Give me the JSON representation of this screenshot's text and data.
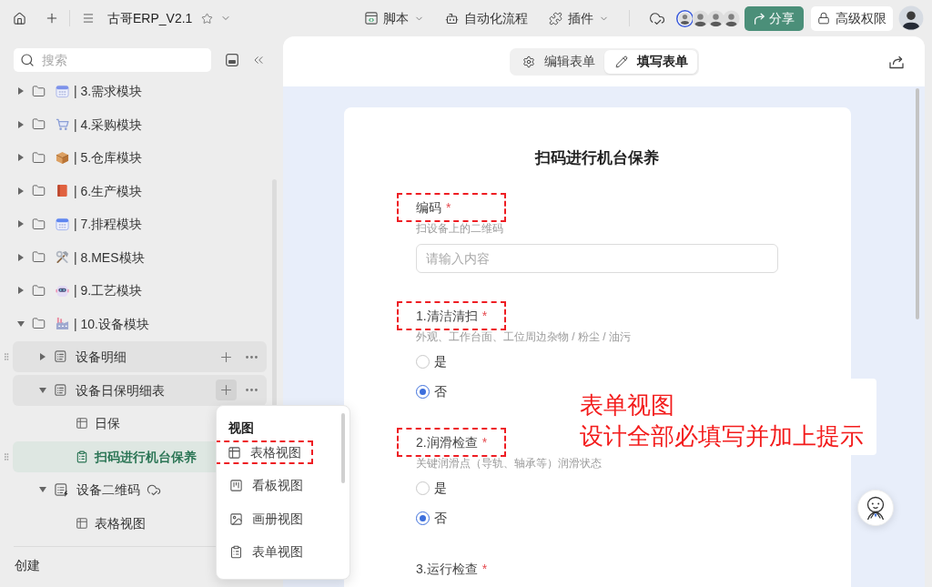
{
  "toolbar": {
    "title": "古哥ERP_V2.1",
    "starred": false,
    "menus": [
      {
        "label": "脚本",
        "dropdown": true
      },
      {
        "label": "自动化流程",
        "dropdown": false
      },
      {
        "label": "插件",
        "dropdown": true
      }
    ],
    "synced": true,
    "collaborators": [
      {
        "active": true
      },
      {
        "active": false
      },
      {
        "active": false
      },
      {
        "active": false
      }
    ],
    "share_button": "分享",
    "permissions_button": "高级权限"
  },
  "sidebar": {
    "search": {
      "placeholder": "搜索"
    },
    "tree": [
      {
        "label": "| 3.需求模块",
        "kind": "folder",
        "expanded": false,
        "selected": false
      },
      {
        "label": "| 4.采购模块",
        "kind": "folder",
        "expanded": false,
        "selected": false
      },
      {
        "label": "| 5.仓库模块",
        "kind": "folder",
        "expanded": false,
        "selected": false
      },
      {
        "label": "| 6.生产模块",
        "kind": "folder",
        "expanded": false,
        "selected": false
      },
      {
        "label": "| 7.排程模块",
        "kind": "folder",
        "expanded": false,
        "selected": false
      },
      {
        "label": "| 8.MES模块",
        "kind": "folder",
        "expanded": false,
        "selected": false
      },
      {
        "label": "| 9.工艺模块",
        "kind": "folder",
        "expanded": false,
        "selected": false
      },
      {
        "label": "| 10.设备模块",
        "kind": "folder",
        "expanded": true,
        "selected": false,
        "children": [
          {
            "label": "设备明细",
            "kind": "table",
            "expanded": false,
            "selected": false,
            "hovered": true,
            "menu_open": false,
            "synced": false
          },
          {
            "label": "设备日保明细表",
            "kind": "table",
            "expanded": true,
            "selected": false,
            "hovered": false,
            "menu_open": true,
            "synced": false,
            "children": [
              {
                "label": "日保",
                "kind": "grid_view",
                "selected": false
              },
              {
                "label": "扫码进行机台保养",
                "kind": "form_view",
                "selected": true
              }
            ]
          },
          {
            "label": "设备二维码",
            "kind": "automation_table",
            "expanded": true,
            "selected": false,
            "hovered": false,
            "menu_open": false,
            "synced": true,
            "children": [
              {
                "label": "表格视图",
                "kind": "grid_view",
                "selected": false
              }
            ]
          }
        ]
      }
    ],
    "create_label": "创建"
  },
  "view_menu": {
    "title": "视图",
    "items": [
      {
        "label": "表格视图",
        "annotated": true
      },
      {
        "label": "看板视图",
        "annotated": false
      },
      {
        "label": "画册视图",
        "annotated": false
      },
      {
        "label": "表单视图",
        "annotated": false
      }
    ]
  },
  "form_view": {
    "tabs": [
      {
        "label": "编辑表单",
        "selected": false
      },
      {
        "label": "填写表单",
        "selected": true
      }
    ],
    "title": "扫码进行机台保养",
    "fields": [
      {
        "kind": "text",
        "label": "编码",
        "required_mark": "*",
        "annotated": true,
        "hint": "扫设备上的二维码",
        "placeholder": "请输入内容"
      },
      {
        "kind": "radio",
        "label": "1.清洁清扫",
        "required_mark": "*",
        "annotated": true,
        "hint": "外观、工作台面、工位周边杂物 / 粉尘 / 油污",
        "options": [
          {
            "label": "是",
            "selected": false
          },
          {
            "label": "否",
            "selected": true
          }
        ]
      },
      {
        "kind": "radio",
        "label": "2.润滑检查",
        "required_mark": "*",
        "annotated": true,
        "hint": "关键润滑点（导轨、轴承等）润滑状态",
        "options": [
          {
            "label": "是",
            "selected": false
          },
          {
            "label": "否",
            "selected": true
          }
        ]
      },
      {
        "kind": "radio",
        "label": "3.运行检查",
        "required_mark": "*",
        "annotated": false
      }
    ]
  },
  "annotation_note": {
    "lines": [
      "表单视图",
      "设计全部必填写并加上提示"
    ]
  }
}
